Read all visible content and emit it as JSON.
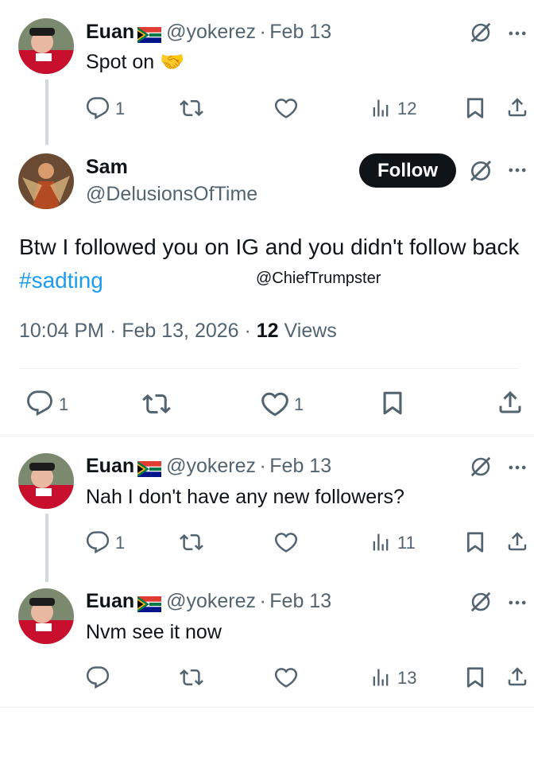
{
  "reply1": {
    "name": "Euan",
    "handle": "@yokerez",
    "sep": "·",
    "date": "Feb 13",
    "text": "Spot on 🤝",
    "replies": "1",
    "views": "12"
  },
  "main": {
    "name": "Sam",
    "handle": "@DelusionsOfTime",
    "follow": "Follow",
    "text": "Btw I followed you on IG and you didn't follow back",
    "hashtag": "#sadting",
    "watermark": "@ChiefTrumpster",
    "timestamp": "10:04 PM · Feb 13, 2026 · ",
    "views_count": "12",
    "views_label": " Views",
    "replies": "1",
    "likes": "1"
  },
  "reply2": {
    "name": "Euan",
    "handle": "@yokerez",
    "sep": "·",
    "date": "Feb 13",
    "text": "Nah I don't have any new followers?",
    "replies": "1",
    "views": "11"
  },
  "reply3": {
    "name": "Euan",
    "handle": "@yokerez",
    "sep": "·",
    "date": "Feb 13",
    "text": "Nvm see it now",
    "views": "13"
  },
  "icons": {
    "reply": "reply-icon",
    "retweet": "retweet-icon",
    "like": "heart-icon",
    "views": "analytics-icon",
    "bookmark": "bookmark-icon",
    "share": "share-icon",
    "grok": "grok-icon",
    "more": "more-icon"
  },
  "colors": {
    "link": "#1d9bf0",
    "muted": "#536471",
    "text": "#0f1419"
  }
}
